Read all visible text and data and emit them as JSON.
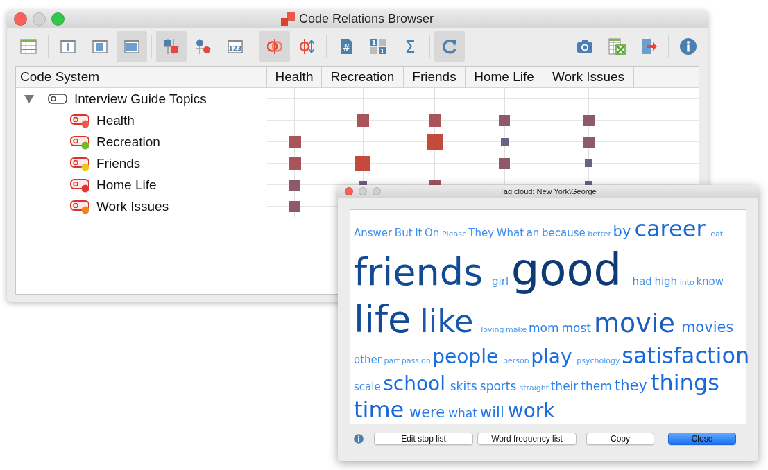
{
  "main_window": {
    "title": "Code Relations Browser",
    "toolbar": {
      "left": [
        [
          {
            "kind": "table",
            "selected": false
          }
        ],
        [
          {
            "kind": "column-layout",
            "selected": false
          },
          {
            "kind": "panel-layout",
            "selected": false
          },
          {
            "kind": "window-layout",
            "selected": true
          }
        ],
        [
          {
            "kind": "square-matrix",
            "selected": true
          },
          {
            "kind": "node-matrix",
            "selected": false
          },
          {
            "kind": "number-box",
            "glyph": "123",
            "selected": false
          }
        ],
        [
          {
            "kind": "overlap-circles",
            "selected": true
          },
          {
            "kind": "circle-arrows",
            "selected": false
          }
        ],
        [
          {
            "kind": "hash-document",
            "glyph": "#",
            "selected": false
          },
          {
            "kind": "number-grid",
            "glyphs": [
              "1",
              "1"
            ],
            "selected": false
          },
          {
            "kind": "sigma",
            "glyph": "Σ",
            "selected": false
          }
        ],
        [
          {
            "kind": "refresh",
            "selected": true
          }
        ]
      ],
      "right": [
        [
          {
            "kind": "camera",
            "selected": false
          },
          {
            "kind": "spreadsheet-export",
            "selected": false
          },
          {
            "kind": "export-arrow",
            "selected": false
          }
        ],
        [
          {
            "kind": "info",
            "selected": false
          }
        ]
      ]
    },
    "matrix": {
      "columns": [
        "Code System",
        "Health",
        "Recreation",
        "Friends",
        "Home Life",
        "Work Issues"
      ],
      "root": {
        "label": "Interview Guide Topics",
        "expanded": true,
        "children": [
          {
            "label": "Health",
            "color": "#ee5a4a",
            "cells": [
              null,
              {
                "kind": "large",
                "color": "#a8545a"
              },
              {
                "kind": "large",
                "color": "#a8545a"
              },
              {
                "kind": "medium",
                "color": "#8e5a6a"
              },
              {
                "kind": "medium",
                "color": "#8e5a6a"
              }
            ]
          },
          {
            "label": "Recreation",
            "color": "#76b82a",
            "cells": [
              {
                "kind": "large",
                "color": "#a8545a"
              },
              null,
              {
                "kind": "largest",
                "color": "#c44a3e"
              },
              {
                "kind": "small",
                "color": "#6e6080"
              },
              {
                "kind": "medium",
                "color": "#8e5a6a"
              }
            ]
          },
          {
            "label": "Friends",
            "color": "#f0c419",
            "cells": [
              {
                "kind": "large",
                "color": "#a8545a"
              },
              {
                "kind": "largest",
                "color": "#c44a3e"
              },
              null,
              {
                "kind": "medium",
                "color": "#8e5a6a"
              },
              {
                "kind": "small",
                "color": "#6e6080"
              }
            ]
          },
          {
            "label": "Home Life",
            "color": "#dc3a2e",
            "cells": [
              {
                "kind": "medium",
                "color": "#8e5a6a"
              },
              {
                "kind": "small",
                "color": "#6e6080"
              },
              {
                "kind": "medium",
                "color": "#a05462"
              },
              null,
              {
                "kind": "small",
                "color": "#6e6080"
              }
            ]
          },
          {
            "label": "Work Issues",
            "color": "#f0861c",
            "cells": [
              {
                "kind": "medium",
                "color": "#8e5a6a"
              },
              null,
              null,
              null,
              null
            ]
          }
        ]
      }
    }
  },
  "tag_cloud_window": {
    "title": "Tag cloud: New York\\George",
    "lines": [
      [
        {
          "text": "Answer",
          "kind": "s"
        },
        {
          "text": "But",
          "kind": "s"
        },
        {
          "text": "It",
          "kind": "s"
        },
        {
          "text": "On",
          "kind": "s"
        },
        {
          "text": "Please",
          "kind": "xs"
        },
        {
          "text": "They",
          "kind": "s"
        },
        {
          "text": "What",
          "kind": "s"
        },
        {
          "text": "an",
          "kind": "s"
        },
        {
          "text": "because",
          "kind": "s"
        },
        {
          "text": "better",
          "kind": "xs"
        },
        {
          "text": "by",
          "kind": "l"
        },
        {
          "text": "career",
          "kind": "xxl"
        },
        {
          "text": "eat",
          "kind": "xs"
        }
      ],
      [
        {
          "text": "friends",
          "kind": "h3"
        },
        {
          "text": "girl",
          "kind": "s"
        },
        {
          "text": "good",
          "kind": "h4"
        },
        {
          "text": "had",
          "kind": "s"
        },
        {
          "text": "high",
          "kind": "s"
        },
        {
          "text": "into",
          "kind": "xs"
        },
        {
          "text": "know",
          "kind": "s"
        }
      ],
      [
        {
          "text": "life",
          "kind": "h3"
        },
        {
          "text": "like",
          "kind": "h2"
        },
        {
          "text": "loving",
          "kind": "xs"
        },
        {
          "text": "make",
          "kind": "xs"
        },
        {
          "text": "mom",
          "kind": "m"
        },
        {
          "text": "most",
          "kind": "m"
        },
        {
          "text": "movie",
          "kind": "h1"
        },
        {
          "text": "movies",
          "kind": "l"
        }
      ],
      [
        {
          "text": "other",
          "kind": "s"
        },
        {
          "text": "part",
          "kind": "xs"
        },
        {
          "text": "passion",
          "kind": "xs"
        },
        {
          "text": "people",
          "kind": "xl"
        },
        {
          "text": "person",
          "kind": "xs"
        },
        {
          "text": "play",
          "kind": "xl"
        },
        {
          "text": "psychology",
          "kind": "xs"
        },
        {
          "text": "satisfaction",
          "kind": "xxl"
        }
      ],
      [
        {
          "text": "scale",
          "kind": "s"
        },
        {
          "text": "school",
          "kind": "xl"
        },
        {
          "text": "skits",
          "kind": "m"
        },
        {
          "text": "sports",
          "kind": "m"
        },
        {
          "text": "straight",
          "kind": "xs"
        },
        {
          "text": "their",
          "kind": "m"
        },
        {
          "text": "them",
          "kind": "m"
        },
        {
          "text": "they",
          "kind": "l"
        },
        {
          "text": "things",
          "kind": "xxl"
        }
      ],
      [
        {
          "text": "time",
          "kind": "xxl"
        },
        {
          "text": "were",
          "kind": "l"
        },
        {
          "text": "what",
          "kind": "m"
        },
        {
          "text": "will",
          "kind": "l"
        },
        {
          "text": "work",
          "kind": "xl"
        }
      ]
    ],
    "buttons": [
      {
        "label": "Edit stop list",
        "primary": false
      },
      {
        "label": "Word frequency list",
        "primary": false
      },
      {
        "label": "Copy",
        "primary": false
      },
      {
        "label": "Close",
        "primary": true
      }
    ]
  }
}
